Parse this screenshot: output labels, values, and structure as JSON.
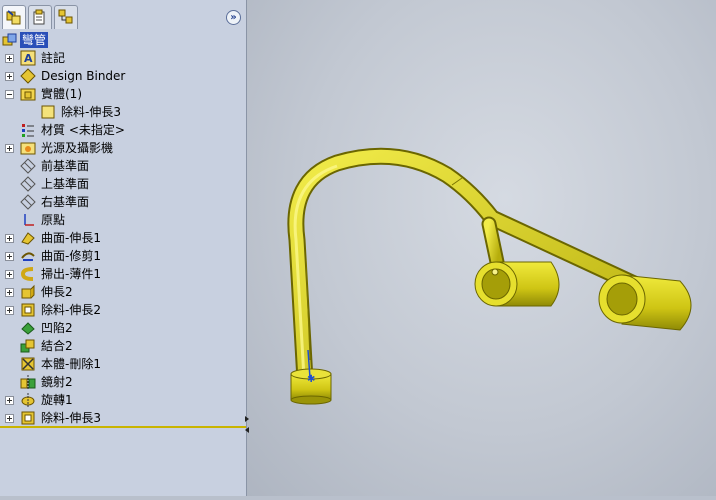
{
  "feature_manager": {
    "tabs": [
      {
        "name": "feature-tree-tab"
      },
      {
        "name": "property-manager-tab"
      },
      {
        "name": "configuration-manager-tab"
      }
    ],
    "expand_glyph": "»",
    "tree": [
      {
        "label": "彎管",
        "icon": "part-icon",
        "root": true,
        "expander": "none"
      },
      {
        "label": "註記",
        "icon": "annotations-icon",
        "expander": "plus"
      },
      {
        "label": "Design Binder",
        "icon": "design-binder-icon",
        "expander": "plus"
      },
      {
        "label": "實體(1)",
        "icon": "solid-bodies-folder-icon",
        "expander": "minus"
      },
      {
        "label": "除料-伸長3",
        "icon": "solid-body-icon",
        "expander": "none",
        "child": true
      },
      {
        "label": "材質 <未指定>",
        "icon": "material-icon",
        "expander": "none"
      },
      {
        "label": "光源及攝影機",
        "icon": "lights-cameras-icon",
        "expander": "plus"
      },
      {
        "label": "前基準面",
        "icon": "plane-icon",
        "expander": "none"
      },
      {
        "label": "上基準面",
        "icon": "plane-icon",
        "expander": "none"
      },
      {
        "label": "右基準面",
        "icon": "plane-icon",
        "expander": "none"
      },
      {
        "label": "原點",
        "icon": "origin-icon",
        "expander": "none"
      },
      {
        "label": "曲面-伸長1",
        "icon": "surface-extrude-icon",
        "expander": "plus"
      },
      {
        "label": "曲面-修剪1",
        "icon": "surface-trim-icon",
        "expander": "plus"
      },
      {
        "label": "掃出-薄件1",
        "icon": "sweep-thin-icon",
        "expander": "plus"
      },
      {
        "label": "伸長2",
        "icon": "boss-extrude-icon",
        "expander": "plus"
      },
      {
        "label": "除料-伸長2",
        "icon": "cut-extrude-icon",
        "expander": "plus"
      },
      {
        "label": "凹陷2",
        "icon": "indent-icon",
        "expander": "none"
      },
      {
        "label": "結合2",
        "icon": "combine-icon",
        "expander": "none"
      },
      {
        "label": "本體-刪除1",
        "icon": "delete-body-icon",
        "expander": "none"
      },
      {
        "label": "鏡射2",
        "icon": "mirror-icon",
        "expander": "none"
      },
      {
        "label": "旋轉1",
        "icon": "revolve-icon",
        "expander": "plus"
      },
      {
        "label": "除料-伸長3",
        "icon": "cut-extrude-icon",
        "expander": "plus"
      }
    ]
  },
  "colors": {
    "part_yellow": "#d9d21a",
    "part_shadow": "#8f8a06",
    "selection_blue": "#2a4fb8",
    "splitter": "#c9b400"
  }
}
